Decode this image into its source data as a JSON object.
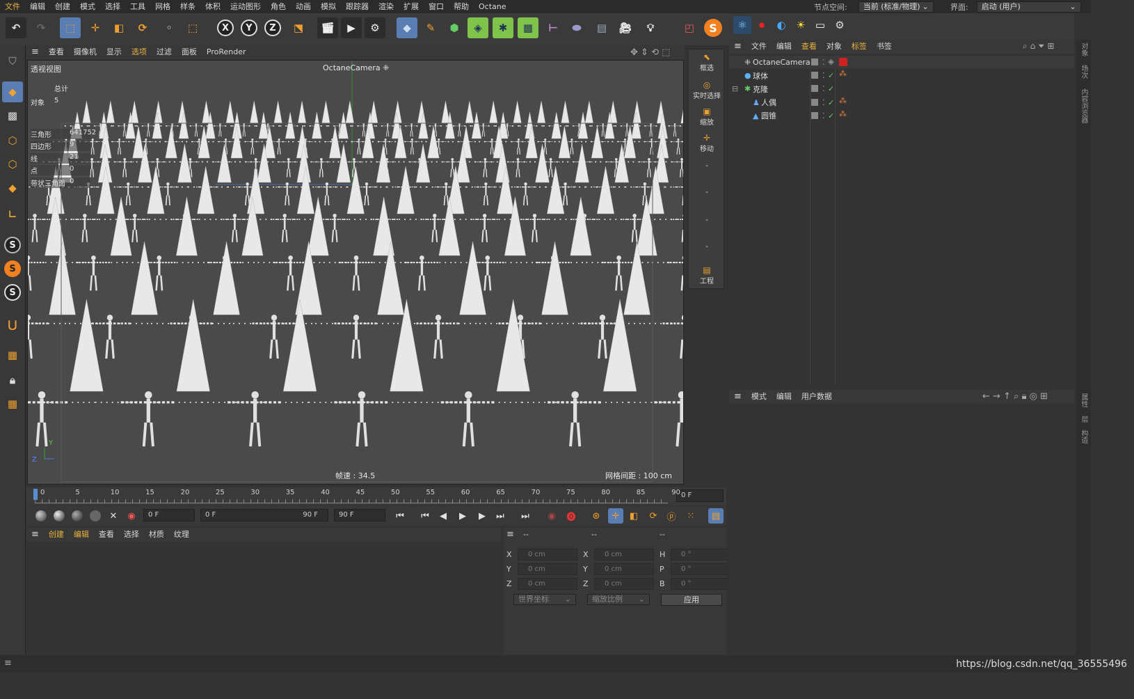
{
  "menubar": {
    "items": [
      "文件",
      "编辑",
      "创建",
      "模式",
      "选择",
      "工具",
      "网格",
      "样条",
      "体积",
      "运动图形",
      "角色",
      "动画",
      "模拟",
      "跟踪器",
      "渲染",
      "扩展",
      "窗口",
      "帮助",
      "Octane"
    ],
    "node_space_label": "节点空间:",
    "node_space_value": "当前 (标准/物理)",
    "layout_label": "界面:",
    "layout_value": "启动 (用户)"
  },
  "toolbar": {
    "axis_x": "X",
    "axis_y": "Y",
    "axis_z": "Z",
    "octane_s": "S"
  },
  "left_tools": {
    "s1": "S",
    "s2": "S",
    "s3": "S"
  },
  "viewport": {
    "menu": [
      "查看",
      "摄像机",
      "显示",
      "选项",
      "过滤",
      "面板",
      "ProRender"
    ],
    "title": "透视视图",
    "camera_label": "OctaneCamera",
    "stats_header": "总计",
    "stats": [
      {
        "label": "对象",
        "value": "5"
      },
      {
        "label": "三角形",
        "value": "641752"
      },
      {
        "label": "四边形",
        "value": "9"
      },
      {
        "label": "线",
        "value": "21"
      },
      {
        "label": "点",
        "value": "0"
      },
      {
        "label": "带状三角面",
        "value": "0"
      }
    ],
    "frame_speed": "帧速 : 34.5",
    "grid_spacing": "网格间距 : 100 cm",
    "axis_y": "Y",
    "axis_z": "Z"
  },
  "right_tools": [
    {
      "label": "框选"
    },
    {
      "label": "实时选择"
    },
    {
      "label": "缩放"
    },
    {
      "label": "移动"
    },
    {
      "label": "-"
    },
    {
      "label": "-"
    },
    {
      "label": "-"
    },
    {
      "label": "-"
    },
    {
      "label": "工程"
    }
  ],
  "timeline": {
    "ticks": [
      "0",
      "5",
      "10",
      "15",
      "20",
      "25",
      "30",
      "35",
      "40",
      "45",
      "50",
      "55",
      "60",
      "65",
      "70",
      "75",
      "80",
      "85",
      "90"
    ],
    "current_frame": "0 F"
  },
  "playbar": {
    "field_current": "0 F",
    "range_start": "0 F",
    "range_end": "90 F",
    "field_end": "90 F"
  },
  "material_manager": {
    "menu": [
      "创建",
      "编辑",
      "查看",
      "选择",
      "材质",
      "纹理"
    ]
  },
  "coordinates": {
    "header": [
      "--",
      "--",
      "--"
    ],
    "rows": [
      {
        "a": "X",
        "av": "0 cm",
        "b": "X",
        "bv": "0 cm",
        "c": "H",
        "cv": "0 °"
      },
      {
        "a": "Y",
        "av": "0 cm",
        "b": "Y",
        "bv": "0 cm",
        "c": "P",
        "cv": "0 °"
      },
      {
        "a": "Z",
        "av": "0 cm",
        "b": "Z",
        "bv": "0 cm",
        "c": "B",
        "cv": "0 °"
      }
    ],
    "world_coords": "世界坐标",
    "scale": "缩放比例",
    "apply": "应用"
  },
  "object_manager": {
    "menu": [
      "文件",
      "编辑",
      "查看",
      "对象",
      "标签",
      "书签"
    ],
    "objects": [
      {
        "name": "OctaneCamera",
        "icon": "camera-icon"
      },
      {
        "name": "球体",
        "icon": "sphere-icon"
      },
      {
        "name": "克隆",
        "icon": "cloner-icon"
      },
      {
        "name": "人偶",
        "icon": "figure-icon"
      },
      {
        "name": "圆锥",
        "icon": "cone-icon"
      }
    ]
  },
  "attribute_manager": {
    "menu": [
      "模式",
      "编辑",
      "用户数据"
    ]
  },
  "right_tabs": [
    "对象",
    "场次",
    "内容浏览器",
    "属性",
    "层",
    "构造"
  ],
  "watermark": "https://blog.csdn.net/qq_36555496",
  "colors": {
    "accent": "#e8b23c",
    "panel": "#383838",
    "viewport_bg": "#474747"
  }
}
